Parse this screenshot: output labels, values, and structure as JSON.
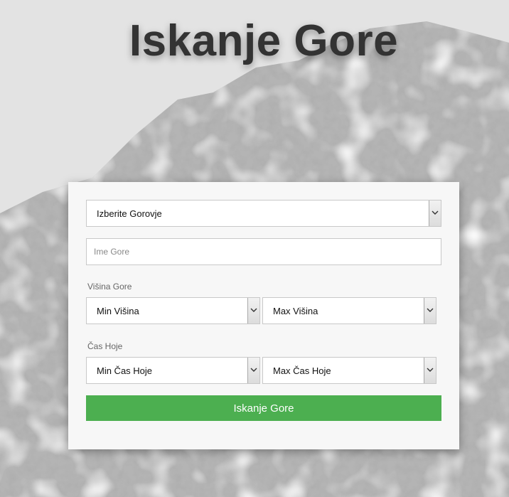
{
  "title": "Iskanje Gore",
  "form": {
    "range_select": "Izberite Gorovje",
    "name_placeholder": "Ime Gore",
    "height_label": "Višina Gore",
    "min_height": "Min Višina",
    "max_height": "Max Višina",
    "time_label": "Čas Hoje",
    "min_time": "Min Čas Hoje",
    "max_time": "Max Čas Hoje",
    "submit_label": "Iskanje Gore"
  },
  "colors": {
    "button": "#4caf50",
    "title": "#333333",
    "card": "#f7f7f7"
  }
}
